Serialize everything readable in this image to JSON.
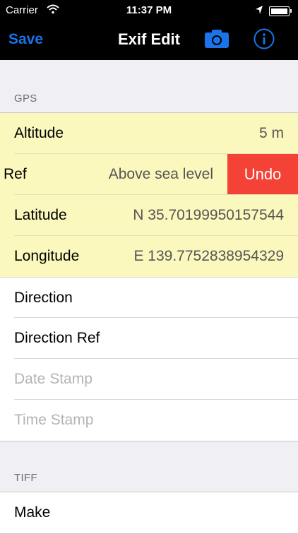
{
  "status_bar": {
    "carrier": "Carrier",
    "time": "11:37 PM"
  },
  "nav": {
    "save_label": "Save",
    "title": "Exif Edit"
  },
  "sections": {
    "gps_header": "GPS",
    "tiff_header": "TIFF"
  },
  "gps_rows": {
    "altitude": {
      "label": "Altitude",
      "value": "5 m"
    },
    "ref": {
      "label": "Ref",
      "value": "Above sea level",
      "action": "Undo"
    },
    "latitude": {
      "label": "Latitude",
      "value": "N 35.70199950157544"
    },
    "longitude": {
      "label": "Longitude",
      "value": "E 139.7752838954329"
    },
    "direction": {
      "label": "Direction"
    },
    "direction_ref": {
      "label": "Direction Ref"
    },
    "date_stamp": {
      "placeholder": "Date Stamp"
    },
    "time_stamp": {
      "placeholder": "Time Stamp"
    }
  },
  "tiff_rows": {
    "make": {
      "label": "Make"
    }
  },
  "colors": {
    "accent": "#1a73e8",
    "highlight": "#fbf8be",
    "undo": "#f44336"
  },
  "icons": [
    "wifi-icon",
    "location-arrow-icon",
    "battery-icon",
    "camera-icon",
    "info-icon"
  ]
}
